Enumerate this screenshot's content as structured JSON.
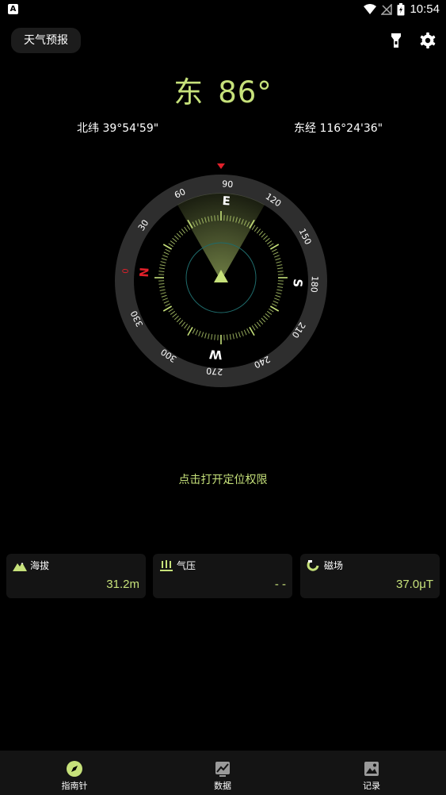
{
  "status_bar": {
    "time": "10:54",
    "app_icon_letter": "A"
  },
  "header": {
    "weather_button": "天气预报"
  },
  "heading": {
    "direction": "东",
    "degrees": "86°"
  },
  "coordinates": {
    "latitude": "北纬 39°54'59\"",
    "longitude": "东经 116°24'36\""
  },
  "compass": {
    "heading_deg": 86,
    "cardinals": {
      "north": "N",
      "east": "E",
      "south": "S",
      "west": "W"
    },
    "north_marker": "0",
    "degree_labels": [
      "30",
      "60",
      "90",
      "120",
      "150",
      "180",
      "210",
      "240",
      "270",
      "300",
      "330"
    ]
  },
  "permission_prompt": "点击打开定位权限",
  "cards": [
    {
      "label": "海拔",
      "value": "31.2m",
      "icon": "mountain-icon"
    },
    {
      "label": "气压",
      "value": "- -",
      "icon": "pressure-icon"
    },
    {
      "label": "磁场",
      "value": "37.0μT",
      "icon": "magnet-icon"
    }
  ],
  "nav": [
    {
      "label": "指南针",
      "icon": "compass-icon",
      "active": true
    },
    {
      "label": "数据",
      "icon": "chart-icon",
      "active": false
    },
    {
      "label": "记录",
      "icon": "image-icon",
      "active": false
    }
  ],
  "colors": {
    "accent": "#c6e17a",
    "north": "#e0202a",
    "card_bg": "#141414"
  }
}
